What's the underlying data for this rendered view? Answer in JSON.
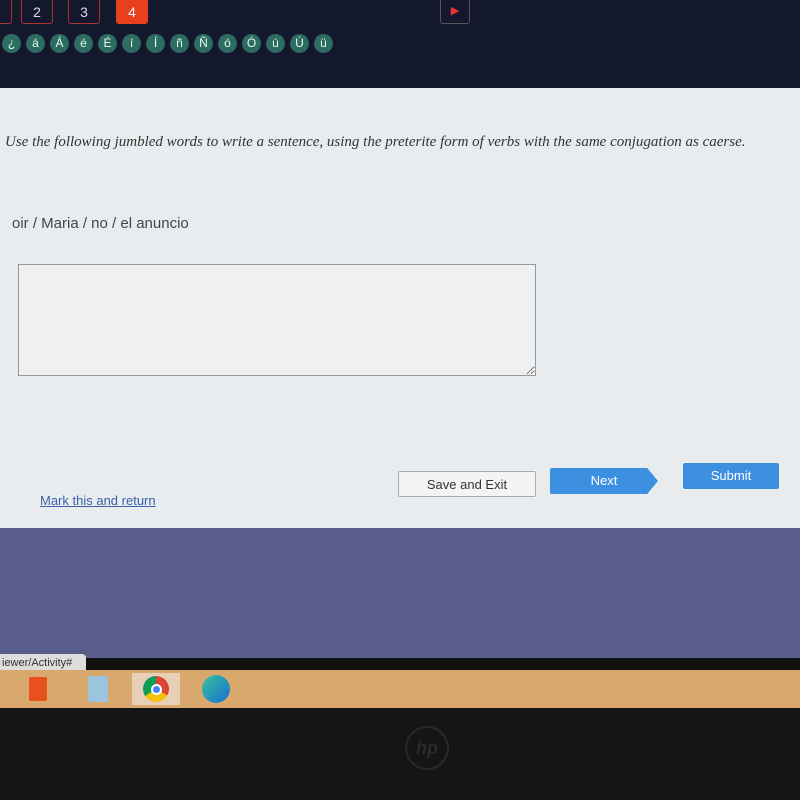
{
  "nav": {
    "questions": [
      "2",
      "3",
      "4"
    ],
    "active": "4"
  },
  "special_chars": [
    "¿",
    "á",
    "Á",
    "é",
    "É",
    "í",
    "Í",
    "ñ",
    "Ñ",
    "ó",
    "Ó",
    "ú",
    "Ú",
    "ü"
  ],
  "question": {
    "prompt": "Use the following jumbled words to write a sentence, using the preterite form of verbs with the same conjugation as caerse.",
    "words": "oir / Maria / no / el anuncio",
    "answer": ""
  },
  "actions": {
    "mark": "Mark this and return",
    "save": "Save and Exit",
    "next": "Next",
    "submit": "Submit"
  },
  "status_url": "iewer/Activity#",
  "taskbar": [
    "office-icon",
    "calculator-icon",
    "chrome-icon",
    "edge-icon"
  ],
  "brand": "hp",
  "colors": {
    "active_question": "#e8401c",
    "primary_button": "#3d8fe0",
    "char_button": "#2e6b63"
  }
}
